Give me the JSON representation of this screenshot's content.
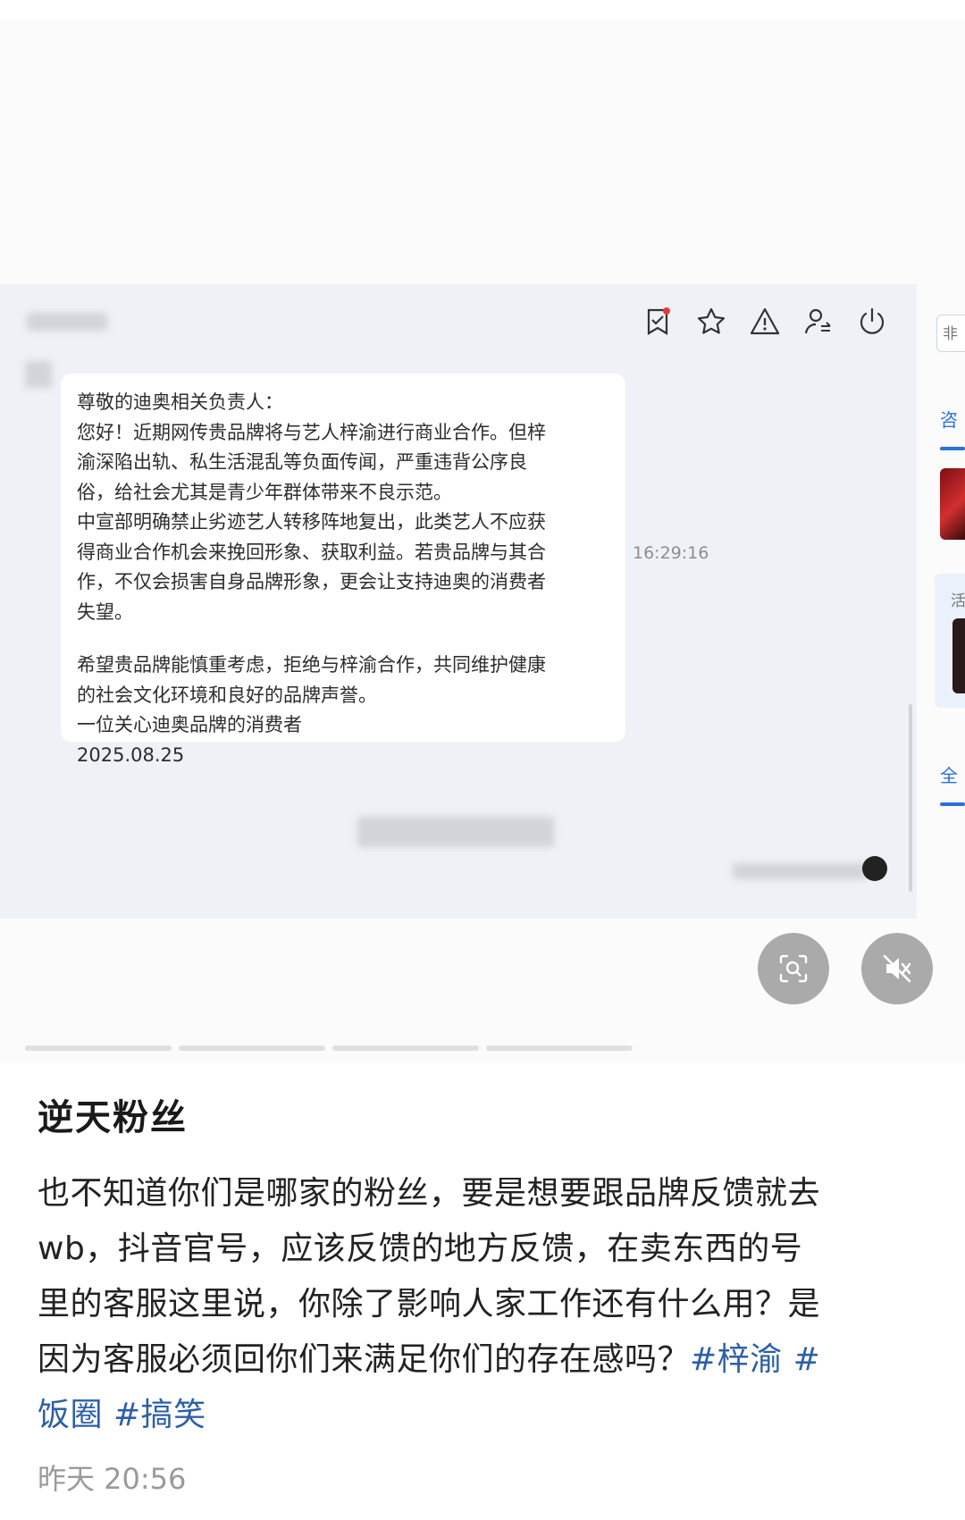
{
  "post": {
    "title": "逆天粉丝",
    "body_lines": [
      "也不知道你们是哪家的粉丝，要是想要跟品牌反馈就去",
      "wb，抖音官号，应该反馈的地方反馈，在卖东西的号",
      "里的客服这里说，你除了影响人家工作还有什么用？是"
    ],
    "body_line4_text": "因为客服必须回你们来满足你们的存在感吗？",
    "hashtags": [
      "#梓渝",
      "#",
      "饭圈",
      "#搞笑"
    ],
    "timestamp": "昨天 20:56"
  },
  "screenshot": {
    "message_lines": [
      "尊敬的迪奥相关负责人：",
      "您好！近期网传贵品牌将与艺人梓渝进行商业合作。但梓",
      "渝深陷出轨、私生活混乱等负面传闻，严重违背公序良",
      "俗，给社会尤其是青少年群体带来不良示范。",
      "中宣部明确禁止劣迹艺人转移阵地复出，此类艺人不应获",
      "得商业合作机会来挽回形象、获取利益。若贵品牌与其合",
      "作，不仅会损害自身品牌形象，更会让支持迪奥的消费者",
      "失望。"
    ],
    "message_lines_2": [
      "希望贵品牌能慎重考虑，拒绝与梓渝合作，共同维护健康",
      "的社会文化环境和良好的品牌声誉。",
      "一位关心迪奥品牌的消费者",
      "2025.08.25"
    ],
    "message_time": "16:29:16",
    "side_tag": "非",
    "side_labels": [
      "咨",
      "全"
    ],
    "side_card_label": "活",
    "toolbar_icons": [
      "bookmark-check-icon",
      "star-icon",
      "warning-icon",
      "user-transfer-icon",
      "power-icon"
    ]
  },
  "overlay_buttons": [
    "image-search-icon",
    "mute-icon"
  ],
  "colors": {
    "hashtag": "#2d5fa8",
    "accent": "#2b71d8",
    "bg_screenshot": "#eef1f6"
  }
}
